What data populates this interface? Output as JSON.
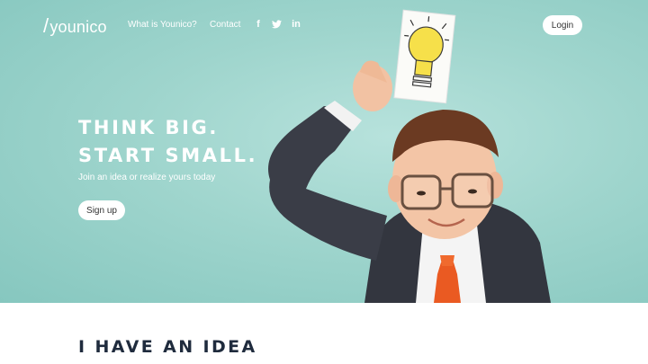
{
  "header": {
    "logo_text": "younico",
    "nav": [
      {
        "label": "What is Younico?"
      },
      {
        "label": "Contact"
      }
    ],
    "social": [
      {
        "icon": "facebook-icon",
        "glyph": "f"
      },
      {
        "icon": "twitter-icon",
        "glyph": "🐦"
      },
      {
        "icon": "linkedin-icon",
        "glyph": "in"
      }
    ],
    "login_label": "Login"
  },
  "hero": {
    "headline_line1": "THINK BIG.",
    "headline_line2": "START SMALL.",
    "subline": "Join an idea or realize yours today",
    "signup_label": "Sign up",
    "background_color": "#9fd5cd"
  },
  "section": {
    "title": "I HAVE AN IDEA"
  }
}
